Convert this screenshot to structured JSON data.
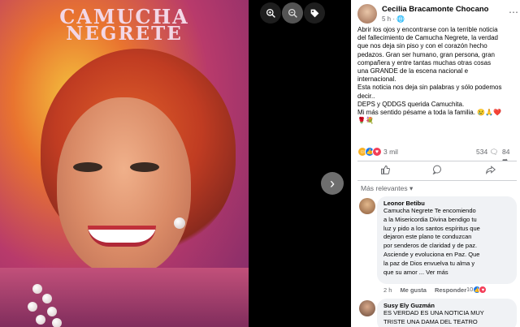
{
  "poster": {
    "title_line1": "CAMUCHA",
    "title_line2": "NEGRETE"
  },
  "viewer_controls": {
    "zoom_in_icon": "zoom-in-icon",
    "zoom_out_icon": "zoom-out-icon",
    "tag_icon": "tag-icon",
    "next_icon": "chevron-right-icon"
  },
  "post": {
    "author": "Cecilia Bracamonte Chocano",
    "time": "5 h",
    "privacy_icon": "globe-icon",
    "text_lines": [
      "Abrir los ojos y encontrarse con la terrible noticia",
      "del fallecimiento de Camucha Negrete, la verdad",
      "que nos deja sin piso y con el corazón hecho",
      "pedazos. Gran ser humano, gran persona, gran",
      "compañera y entre tantas muchas otras cosas",
      "una GRANDE de la escena nacional e",
      "internacional.",
      "Esta noticia nos deja sin palabras y sólo podemos",
      "decir..",
      "DEPS y QDDGS querida Camuchita.",
      "Mi más sentido pésame a toda la familia. 😢🙏❤️",
      "🌹💐"
    ],
    "reaction_count": "3 mil",
    "comment_count": "534",
    "share_count": "84",
    "colors": {
      "like": "#1877f2",
      "love": "#f33e58",
      "care": "#f7b125"
    }
  },
  "comments": {
    "filter_label": "Más relevantes",
    "items": [
      {
        "name": "Leonor Betibu",
        "text_lines": [
          "Camucha Negrete Te encomiendo",
          "a la Misericordia Divina bendigo tu",
          "luz y pido a los santos espíritus que",
          "dejaron este plano te conduzcan",
          "por senderos de claridad y de paz.",
          "Asciende y evoluciona en Paz. Que",
          "la paz de Dios envuelva tu alma y",
          "que su amor ... Ver más"
        ],
        "time": "2 h",
        "like_label": "Me gusta",
        "reply_label": "Responder",
        "reactions": "10"
      },
      {
        "name": "Susy Ely Guzmán",
        "text_lines": [
          "ES VERDAD ES UNA NOTICIA MUY",
          "TRISTE UNA DAMA DEL TEATRO"
        ]
      }
    ]
  }
}
